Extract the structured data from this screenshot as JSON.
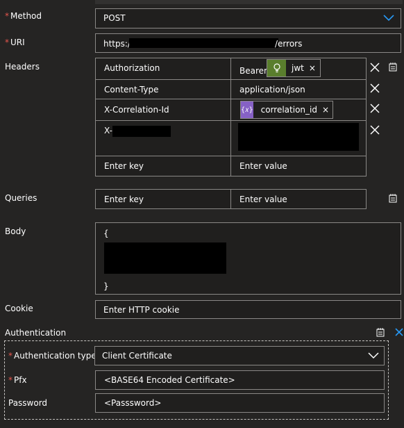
{
  "method": {
    "label": "Method",
    "value": "POST"
  },
  "uri": {
    "label": "URI",
    "value_prefix": "https:/",
    "value_suffix": "/errors"
  },
  "headers": {
    "label": "Headers",
    "rows": [
      {
        "key": "Authorization",
        "value_text": "Bearer",
        "token": {
          "label": "jwt",
          "icon": "bulb-icon",
          "color": "#5a7e2d"
        }
      },
      {
        "key": "Content-Type",
        "value_text": "application/json"
      },
      {
        "key": "X-Correlation-Id",
        "value_text": "",
        "token": {
          "label": "correlation_id",
          "icon": "expression-icon",
          "color": "#8661c5"
        }
      },
      {
        "key": "X-",
        "value_text": ""
      }
    ],
    "key_placeholder": "Enter key",
    "value_placeholder": "Enter value"
  },
  "queries": {
    "label": "Queries",
    "key_placeholder": "Enter key",
    "value_placeholder": "Enter value"
  },
  "body": {
    "label": "Body",
    "line_open": "{",
    "line_close": "}"
  },
  "cookie": {
    "label": "Cookie",
    "placeholder": "Enter HTTP cookie"
  },
  "authentication": {
    "label": "Authentication",
    "type_label": "Authentication type",
    "type_value": "Client Certificate",
    "pfx_label": "Pfx",
    "pfx_value": "<BASE64 Encoded Certificate>",
    "password_label": "Password",
    "password_value": "<Passsword>"
  },
  "colors": {
    "background": "#252423",
    "field_background": "#201f1e",
    "border": "#8a8886",
    "required": "#e8564d",
    "accent": "#2899f5"
  }
}
